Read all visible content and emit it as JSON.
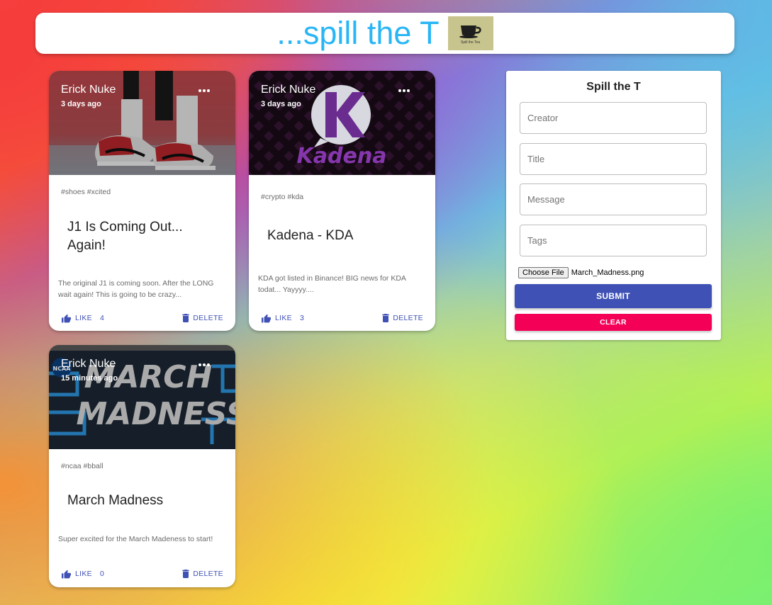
{
  "header": {
    "title": "...spill the T",
    "logo_caption": "Spill the Tea"
  },
  "posts": [
    {
      "creator": "Erick Nuke",
      "time": "3 days ago",
      "tags": "#shoes #xcited",
      "title": "J1 Is Coming Out... Again!",
      "message": "The original J1 is coming soon. After the LONG wait again! This is going to be crazy...",
      "like_label": "LIKE",
      "like_count": "4",
      "delete_label": "DELETE",
      "image": "sneakers-photo"
    },
    {
      "creator": "Erick Nuke",
      "time": "3 days ago",
      "tags": "#crypto #kda",
      "title": "Kadena - KDA",
      "message": "KDA got listed in Binance! BIG news for KDA todat... Yayyyy....",
      "like_label": "LIKE",
      "like_count": "3",
      "delete_label": "DELETE",
      "image": "kadena-logo",
      "image_text": "Kadena",
      "image_letter": "K"
    },
    {
      "creator": "Erick Nuke",
      "time": "15 minutes ago",
      "tags": "#ncaa #bball",
      "title": "March Madness",
      "message": "Super excited for the March Madeness to start!",
      "like_label": "LIKE",
      "like_count": "0",
      "delete_label": "DELETE",
      "image": "march-madness-banner",
      "image_line1": "MARCH",
      "image_line2": "MADNESS",
      "image_badge": "NCAA"
    }
  ],
  "form": {
    "title": "Spill the T",
    "creator_placeholder": "Creator",
    "title_placeholder": "Title",
    "message_placeholder": "Message",
    "tags_placeholder": "Tags",
    "file_button": "Choose File",
    "file_name": "March_Madness.png",
    "submit_label": "SUBMIT",
    "clear_label": "CLEAR"
  },
  "colors": {
    "primary": "#3f51b5",
    "secondary": "#f50057",
    "title": "#29b6f6"
  }
}
